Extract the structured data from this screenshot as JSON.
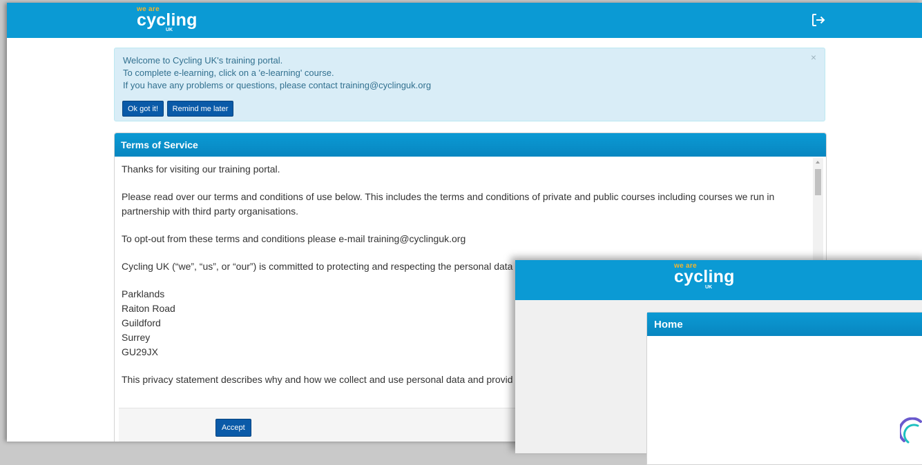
{
  "main": {
    "logo": {
      "we_are": "we are",
      "brand": "cycling",
      "uk": "UK"
    },
    "logout_icon": "logout-icon",
    "alert": {
      "lines": [
        "Welcome to Cycling UK's training portal.",
        "To complete e-learning, click on a 'e-learning' course.",
        "If you have any problems or questions, please contact training@cyclinguk.org"
      ],
      "close": "×",
      "ok_button": "Ok got it!",
      "remind_button": "Remind me later"
    },
    "tos": {
      "title": "Terms of Service",
      "p1": "Thanks for visiting our training portal.",
      "p2": "Please read over our terms and conditions of use below. This includes the terms and conditions of private and public courses including courses we run in partnership with third party organisations.",
      "p3": "To opt-out from these terms and conditions please e-mail training@cyclinguk.org",
      "p4": "Cycling UK (“we”, “us”, or “our”) is committed to protecting and respecting the personal data",
      "address": [
        "Parklands",
        "Raiton Road",
        "Guildford",
        "Surrey",
        "GU29JX"
      ],
      "p5": "This privacy statement describes why and how we collect and use personal data and provid",
      "accept_button": "Accept"
    }
  },
  "front": {
    "logo": {
      "we_are": "we are",
      "brand": "cycling",
      "uk": "UK"
    },
    "home_title": "Home"
  },
  "colors": {
    "brand_blue": "#0b9ad4",
    "button_blue": "#0a5aa8",
    "alert_bg": "#d9edf7",
    "alert_text": "#31708f",
    "logo_yellow": "#f7b52a"
  }
}
